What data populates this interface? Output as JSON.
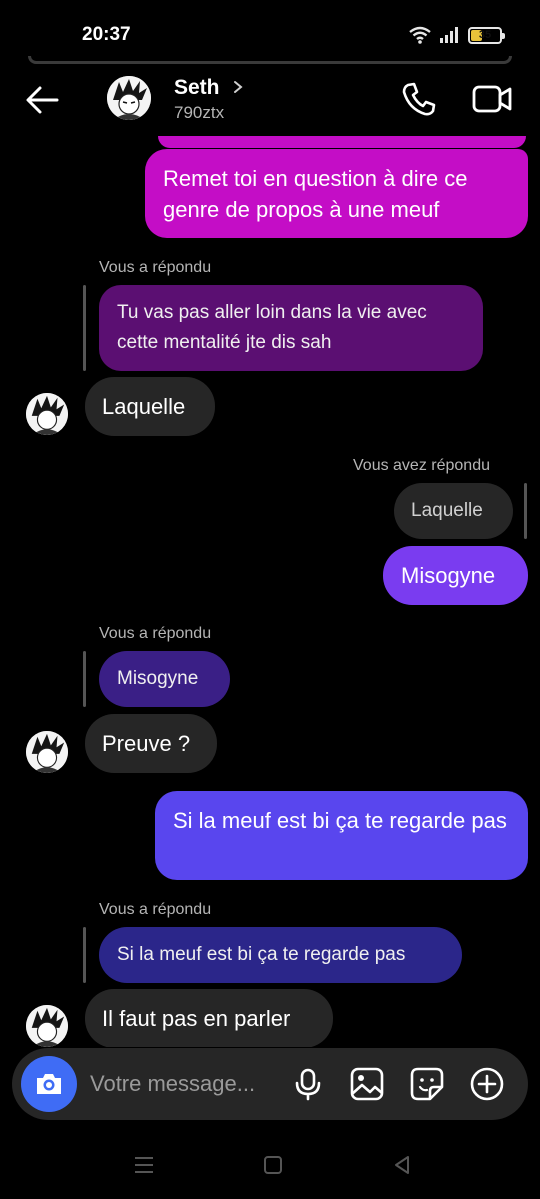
{
  "status": {
    "time": "20:37",
    "battery": "35"
  },
  "header": {
    "name": "Seth",
    "username": "790ztx"
  },
  "messages": {
    "m1": "Remet toi en question à dire ce genre de propos à une meuf",
    "r1_label": "Vous a répondu",
    "r1_quote": "Tu vas pas aller loin dans la vie avec cette mentalité jte dis sah",
    "m2": "Laquelle",
    "r2_label": "Vous avez répondu",
    "r2_quote": "Laquelle",
    "m3": "Misogyne",
    "r3_label": "Vous a répondu",
    "r3_quote": "Misogyne",
    "m4": "Preuve ?",
    "m5": "Si la meuf est bi ça te regarde pas",
    "r4_label": "Vous a répondu",
    "r4_quote": "Si la meuf est bi ça te regarde pas",
    "m6": "Il faut pas en parler"
  },
  "composer": {
    "placeholder": "Votre message..."
  },
  "colors": {
    "bubble_pink": "#c40dc6",
    "bubble_purple": "#7a3cf0",
    "bubble_violet": "#5946ee",
    "reply_dark_purple": "#5b0f72",
    "reply_indigo": "#3a1f86",
    "reply_navy": "#2b268a",
    "incoming_gray": "#262626",
    "accent_blue": "#3f6cf5"
  },
  "icons": [
    "back-arrow-icon",
    "chevron-right-icon",
    "phone-icon",
    "video-camera-icon",
    "camera-icon",
    "microphone-icon",
    "image-icon",
    "sticker-icon",
    "plus-icon",
    "recents-icon",
    "home-icon",
    "back-triangle-icon"
  ]
}
